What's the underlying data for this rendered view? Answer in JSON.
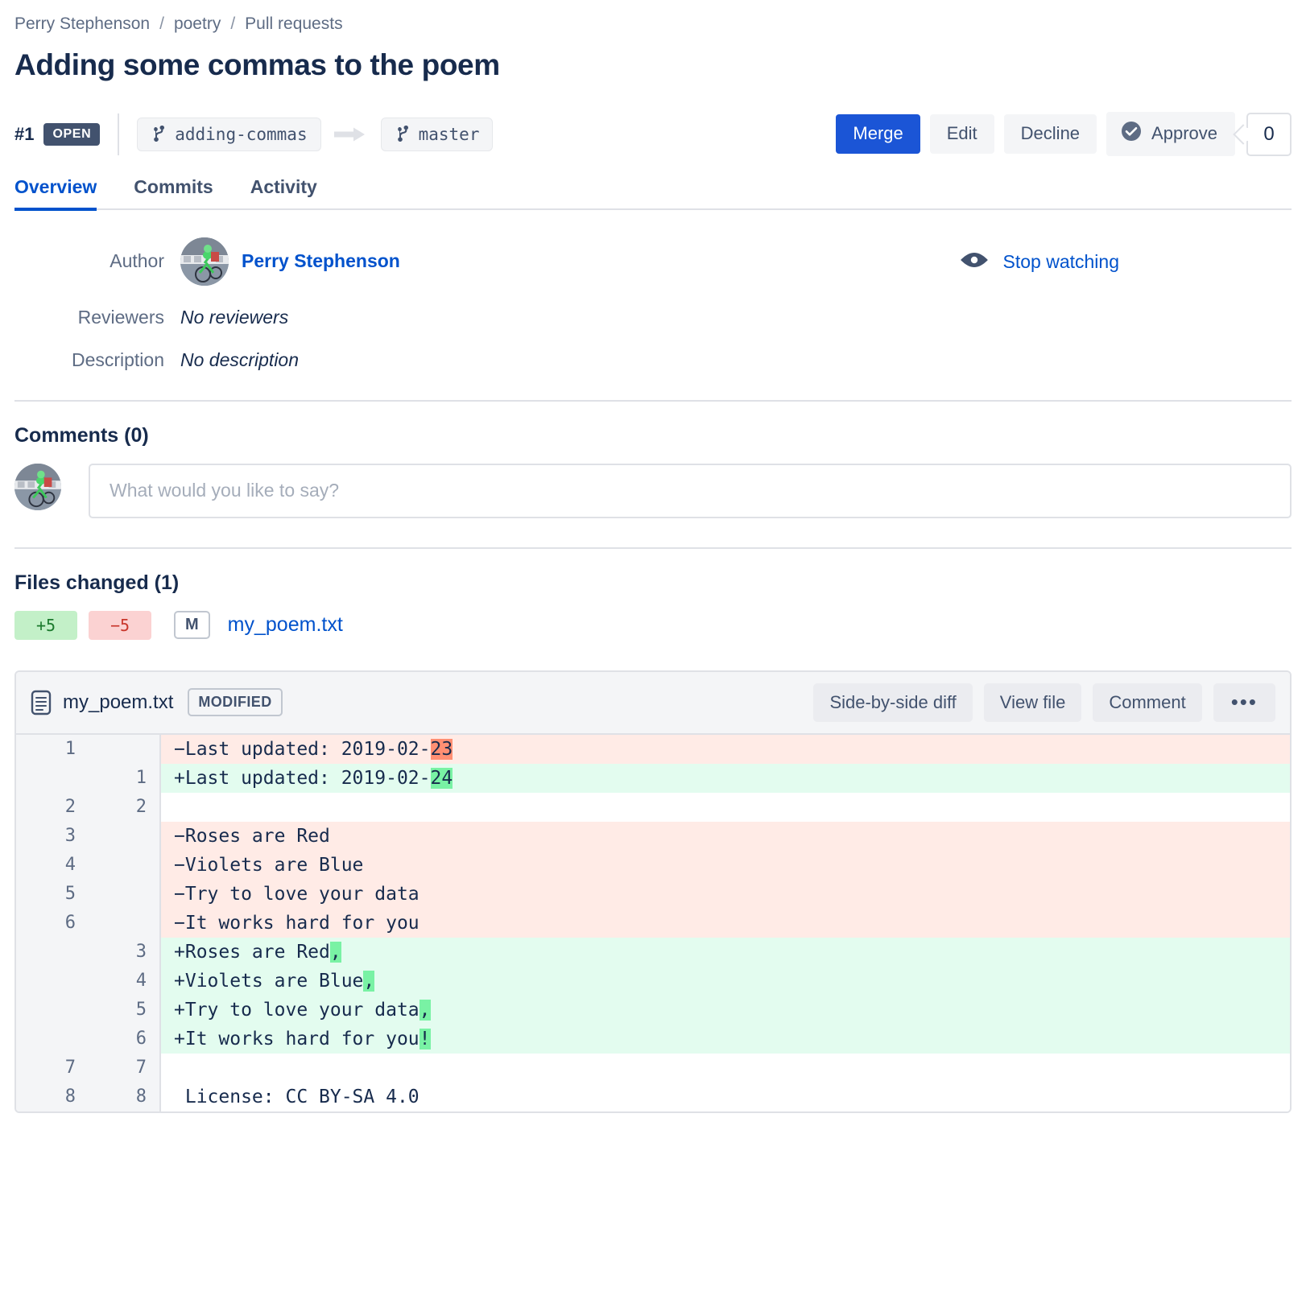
{
  "breadcrumb": {
    "items": [
      "Perry Stephenson",
      "poetry",
      "Pull requests"
    ],
    "separator": "/"
  },
  "title": "Adding some commas to the poem",
  "status": {
    "number": "#1",
    "state": "OPEN",
    "source_branch": "adding-commas",
    "target_branch": "master"
  },
  "actions": {
    "merge": "Merge",
    "edit": "Edit",
    "decline": "Decline",
    "approve": "Approve",
    "approve_count": "0"
  },
  "tabs": [
    {
      "label": "Overview",
      "active": true
    },
    {
      "label": "Commits",
      "active": false
    },
    {
      "label": "Activity",
      "active": false
    }
  ],
  "meta": {
    "author_label": "Author",
    "author_name": "Perry Stephenson",
    "reviewers_label": "Reviewers",
    "reviewers_value": "No reviewers",
    "description_label": "Description",
    "description_value": "No description",
    "watch_label": "Stop watching"
  },
  "comments": {
    "heading": "Comments (0)",
    "placeholder": "What would you like to say?",
    "value": ""
  },
  "files_changed": {
    "heading": "Files changed (1)",
    "additions": "+5",
    "deletions": "−5",
    "status_letter": "M",
    "filename": "my_poem.txt"
  },
  "diff": {
    "filename": "my_poem.txt",
    "tag": "MODIFIED",
    "buttons": {
      "side_by_side": "Side-by-side diff",
      "view_file": "View file",
      "comment": "Comment",
      "more": "•••"
    },
    "lines": [
      {
        "type": "del",
        "old": "1",
        "new": "",
        "prefix": "−",
        "text": "Last updated: 2019-02-",
        "hl": "23",
        "tail": ""
      },
      {
        "type": "add",
        "old": "",
        "new": "1",
        "prefix": "+",
        "text": "Last updated: 2019-02-",
        "hl": "24",
        "tail": ""
      },
      {
        "type": "ctx",
        "old": "2",
        "new": "2",
        "prefix": "",
        "text": "",
        "hl": "",
        "tail": ""
      },
      {
        "type": "del",
        "old": "3",
        "new": "",
        "prefix": "−",
        "text": "Roses are Red",
        "hl": "",
        "tail": ""
      },
      {
        "type": "del",
        "old": "4",
        "new": "",
        "prefix": "−",
        "text": "Violets are Blue",
        "hl": "",
        "tail": ""
      },
      {
        "type": "del",
        "old": "5",
        "new": "",
        "prefix": "−",
        "text": "Try to love your data",
        "hl": "",
        "tail": ""
      },
      {
        "type": "del",
        "old": "6",
        "new": "",
        "prefix": "−",
        "text": "It works hard for you",
        "hl": "",
        "tail": ""
      },
      {
        "type": "add",
        "old": "",
        "new": "3",
        "prefix": "+",
        "text": "Roses are Red",
        "hl": ",",
        "tail": ""
      },
      {
        "type": "add",
        "old": "",
        "new": "4",
        "prefix": "+",
        "text": "Violets are Blue",
        "hl": ",",
        "tail": ""
      },
      {
        "type": "add",
        "old": "",
        "new": "5",
        "prefix": "+",
        "text": "Try to love your data",
        "hl": ",",
        "tail": ""
      },
      {
        "type": "add",
        "old": "",
        "new": "6",
        "prefix": "+",
        "text": "It works hard for you",
        "hl": "!",
        "tail": ""
      },
      {
        "type": "ctx",
        "old": "7",
        "new": "7",
        "prefix": "",
        "text": "",
        "hl": "",
        "tail": ""
      },
      {
        "type": "ctx",
        "old": "8",
        "new": "8",
        "prefix": " ",
        "text": "License: CC BY-SA 4.0",
        "hl": "",
        "tail": ""
      }
    ]
  },
  "colors": {
    "accent": "#0052CC",
    "primary_button": "#1B55D6",
    "open_badge": "#42526E",
    "add_bg": "#E3FCEF",
    "del_bg": "#FFEBE6",
    "add_word": "#79F2A4",
    "del_word": "#FF8F73"
  }
}
